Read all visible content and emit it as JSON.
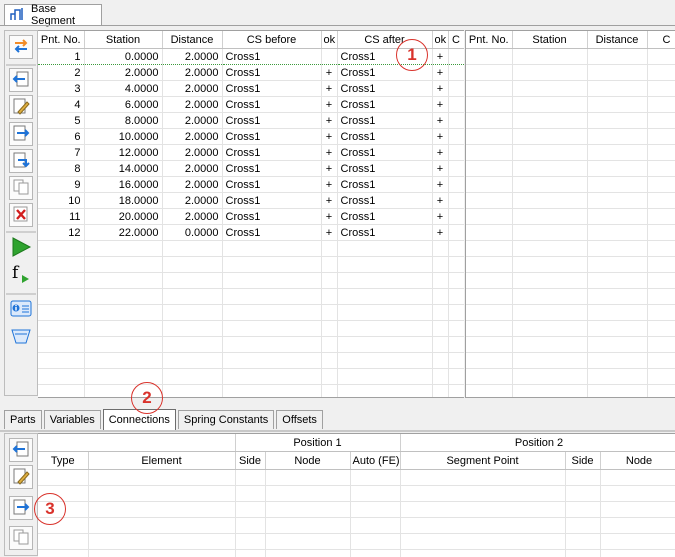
{
  "title_tab": {
    "label": "Base Segment"
  },
  "points_table": {
    "headers": [
      "Pnt. No.",
      "Station",
      "Distance",
      "CS before",
      "ok",
      "CS after",
      "ok",
      "C"
    ],
    "rows": [
      [
        "1",
        "0.0000",
        "2.0000",
        "Cross1",
        "",
        "Cross1",
        "+"
      ],
      [
        "2",
        "2.0000",
        "2.0000",
        "Cross1",
        "+",
        "Cross1",
        "+"
      ],
      [
        "3",
        "4.0000",
        "2.0000",
        "Cross1",
        "+",
        "Cross1",
        "+"
      ],
      [
        "4",
        "6.0000",
        "2.0000",
        "Cross1",
        "+",
        "Cross1",
        "+"
      ],
      [
        "5",
        "8.0000",
        "2.0000",
        "Cross1",
        "+",
        "Cross1",
        "+"
      ],
      [
        "6",
        "10.0000",
        "2.0000",
        "Cross1",
        "+",
        "Cross1",
        "+"
      ],
      [
        "7",
        "12.0000",
        "2.0000",
        "Cross1",
        "+",
        "Cross1",
        "+"
      ],
      [
        "8",
        "14.0000",
        "2.0000",
        "Cross1",
        "+",
        "Cross1",
        "+"
      ],
      [
        "9",
        "16.0000",
        "2.0000",
        "Cross1",
        "+",
        "Cross1",
        "+"
      ],
      [
        "10",
        "18.0000",
        "2.0000",
        "Cross1",
        "+",
        "Cross1",
        "+"
      ],
      [
        "11",
        "20.0000",
        "2.0000",
        "Cross1",
        "+",
        "Cross1",
        "+"
      ],
      [
        "12",
        "22.0000",
        "0.0000",
        "Cross1",
        "+",
        "Cross1",
        "+"
      ]
    ]
  },
  "right_table": {
    "headers": [
      "Pnt. No.",
      "Station",
      "Distance",
      "C"
    ]
  },
  "tabs": [
    {
      "label": "Parts"
    },
    {
      "label": "Variables"
    },
    {
      "label": "Connections"
    },
    {
      "label": "Spring Constants"
    },
    {
      "label": "Offsets"
    }
  ],
  "connections_table": {
    "group_headers": {
      "position1": "Position 1",
      "position2": "Position 2"
    },
    "headers": [
      "Type",
      "Element",
      "Side",
      "Node",
      "Auto (FE)",
      "Segment Point",
      "Side",
      "Node"
    ]
  },
  "annotations": [
    "1",
    "2",
    "3"
  ],
  "icons": [
    "segment-icon",
    "import-icon",
    "insert-left-icon",
    "edit-icon",
    "insert-right-icon",
    "insert-below-icon",
    "copy-icon",
    "delete-icon",
    "run-icon",
    "function-icon",
    "info-icon",
    "filter-icon"
  ],
  "colors": {
    "accent_red": "#d9322b",
    "selection_green": "#3c9a3c",
    "run_green": "#2fa32f"
  }
}
